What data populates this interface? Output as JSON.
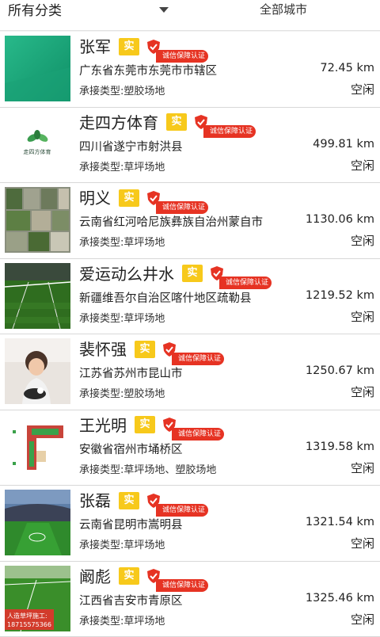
{
  "filters": {
    "category": "所有分类",
    "city": "全部城市"
  },
  "badges": {
    "real": "实",
    "cert": "诚信保障认证"
  },
  "thumbs": {
    "item2_logo_text": "走四方体育",
    "item8_caption_1": "人造草坪施工:",
    "item8_caption_2": "18715575366"
  },
  "items": [
    {
      "name": "张军",
      "address": "广东省东莞市东莞市市辖区",
      "distance": "72.45 km",
      "type": "承接类型:塑胶场地",
      "status": "空闲"
    },
    {
      "name": "走四方体育",
      "address": "四川省遂宁市射洪县",
      "distance": "499.81 km",
      "type": "承接类型:草坪场地",
      "status": "空闲"
    },
    {
      "name": "明义",
      "address": "云南省红河哈尼族彝族自治州蒙自市",
      "distance": "1130.06 km",
      "type": "承接类型:草坪场地",
      "status": "空闲"
    },
    {
      "name": "爱运动么井水",
      "address": "新疆维吾尔自治区喀什地区疏勒县",
      "distance": "1219.52 km",
      "type": "承接类型:草坪场地",
      "status": "空闲"
    },
    {
      "name": "裴怀强",
      "address": "江苏省苏州市昆山市",
      "distance": "1250.67 km",
      "type": "承接类型:塑胶场地",
      "status": "空闲"
    },
    {
      "name": "王光明",
      "address": "安徽省宿州市埇桥区",
      "distance": "1319.58 km",
      "type": "承接类型:草坪场地、塑胶场地",
      "status": "空闲"
    },
    {
      "name": "张磊",
      "address": "云南省昆明市嵩明县",
      "distance": "1321.54 km",
      "type": "承接类型:草坪场地",
      "status": "空闲"
    },
    {
      "name": "阚彪",
      "address": "江西省吉安市青原区",
      "distance": "1325.46 km",
      "type": "承接类型:草坪场地",
      "status": "空闲"
    }
  ]
}
